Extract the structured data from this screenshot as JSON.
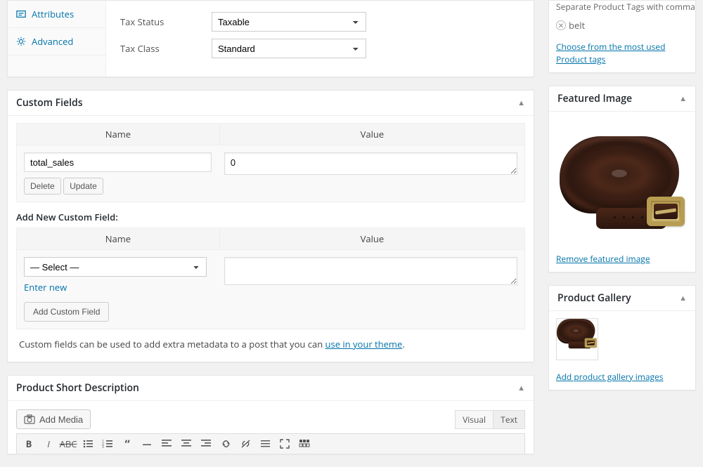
{
  "product_data": {
    "tabs": {
      "attributes": "Attributes",
      "advanced": "Advanced"
    },
    "tax_status_label": "Tax Status",
    "tax_status_value": "Taxable",
    "tax_class_label": "Tax Class",
    "tax_class_value": "Standard"
  },
  "custom_fields": {
    "title": "Custom Fields",
    "name_header": "Name",
    "value_header": "Value",
    "row": {
      "name": "total_sales",
      "value": "0"
    },
    "delete_btn": "Delete",
    "update_btn": "Update",
    "add_section_label": "Add New Custom Field:",
    "add_name_header": "Name",
    "add_value_header": "Value",
    "select_placeholder": "— Select —",
    "enter_new_link": "Enter new",
    "add_btn": "Add Custom Field",
    "hint_pre": "Custom fields can be used to add extra metadata to a post that you can ",
    "hint_link": "use in your theme",
    "hint_post": "."
  },
  "short_desc": {
    "title": "Product Short Description",
    "add_media_btn": "Add Media",
    "tab_visual": "Visual",
    "tab_text": "Text"
  },
  "tags_panel": {
    "truncated_hint": "Separate Product Tags with commas",
    "tag": "belt",
    "choose_link": "Choose from the most used Product tags"
  },
  "featured_image": {
    "title": "Featured Image",
    "remove_link": "Remove featured image"
  },
  "gallery": {
    "title": "Product Gallery",
    "add_link": "Add product gallery images"
  }
}
